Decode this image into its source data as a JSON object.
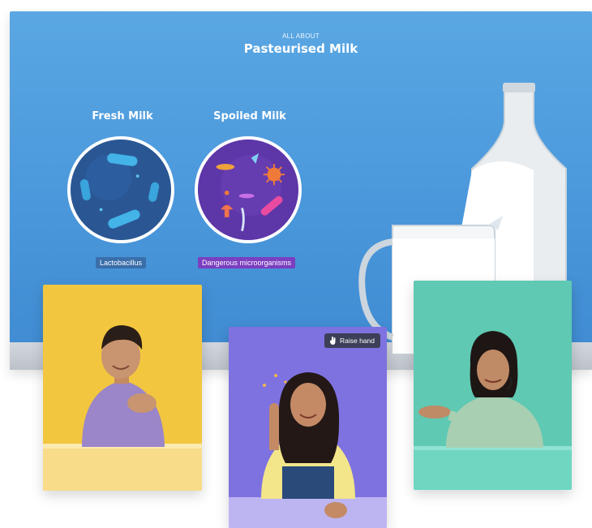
{
  "header": {
    "eyebrow": "ALL ABOUT",
    "title": "Pasteurised Milk"
  },
  "comparison": {
    "fresh": {
      "title": "Fresh Milk",
      "label": "Lactobacillus"
    },
    "spoiled": {
      "title": "Spoiled Milk",
      "label": "Dangerous microorganisms"
    }
  },
  "participants": {
    "boy": {
      "color": "#f2c63f"
    },
    "girl": {
      "color": "#7e72e0",
      "raise_hand_label": "Raise hand",
      "raise_hand_icon": "hand-icon"
    },
    "teacher": {
      "color": "#5fc9b3"
    }
  },
  "colors": {
    "board_blue": "#4a97db",
    "fresh_circle": "#2e5f9e",
    "spoiled_circle": "#6b3fb3",
    "fresh_tag": "#3a6eaa",
    "spoiled_tag": "#7b3fc0"
  }
}
